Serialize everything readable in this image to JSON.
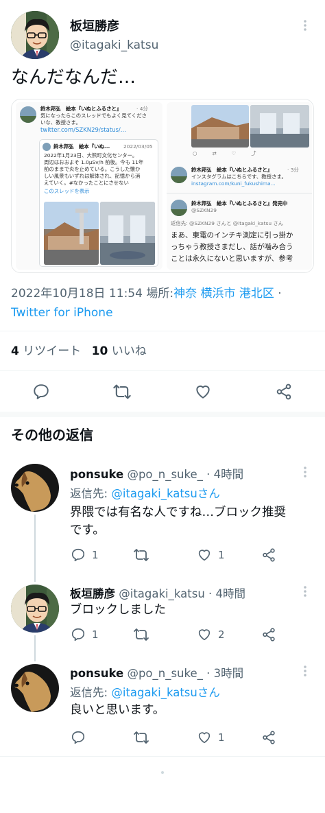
{
  "main_tweet": {
    "author_name": "板垣勝彦",
    "author_handle": "@itagaki_katsu",
    "text": "なんだなんだ…",
    "timestamp": "2022年10月18日 11:54",
    "location_label": "場所:",
    "location": "神奈 横浜市 港北区",
    "location_suffix": "·",
    "client": "Twitter for iPhone",
    "retweets_count": "4",
    "retweets_label": "リツイート",
    "likes_count": "10",
    "likes_label": "いいね"
  },
  "embed": {
    "left": {
      "author": "鈴木邦弘　絵本『いぬとふるさと』",
      "author_time": "· 4分",
      "line1": "気になったらこのスレッドでもよく見てくださ",
      "line2": "いな、教授さま。",
      "link": "twitter.com/SZKN29/status/...",
      "quote_author": "鈴木邦弘　絵本『いぬ...",
      "quote_date": "2022/03/05",
      "quote_lines": [
        "2022年1月23日、大熊町文化センター。",
        "周辺はおおよそ 1.0μSv/h 前後。今も 11年",
        "前のままで炎を止めている。こうした懐か",
        "しい風景もいずれは解体され、記憶から消",
        "えていく。#なかったことにさせない"
      ],
      "thread_link": "このスレッドを表示"
    },
    "right": {
      "author1": "鈴木邦弘　絵本『いぬとふるさと』",
      "author1_time": "· 3分",
      "line1": "インスタグラムはこちらです、教授さま。",
      "link1": "instagram.com/kuni_fukushima...",
      "author2": "鈴木邦弘　絵本『いぬとふるさと』発売中",
      "handle2": "@SZKN29",
      "reply_to": "返信先: @SZKN29 さんと @itagaki_katsu さん",
      "body_lines": [
        "まあ、東電のインチキ測定に引っ掛か",
        "っちゃう教授さまだし、話が噛み合う",
        "ことは永久にないと思いますが、参考"
      ]
    }
  },
  "section_title": "その他の返信",
  "replies": [
    {
      "name": "ponsuke",
      "handle": "@po_n_suke_",
      "time": "· 4時間",
      "reply_prefix": "返信先:",
      "reply_to": "@itagaki_katsuさん",
      "text_lines": [
        "界隈では有名な人ですね…ブロック推奨",
        "です。"
      ],
      "reply_count": "1",
      "retweet_count": "",
      "like_count": "1"
    },
    {
      "name": "板垣勝彦",
      "handle": "@itagaki_katsu",
      "time": "· 4時間",
      "text_lines": [
        "ブロックしました"
      ],
      "reply_count": "1",
      "retweet_count": "",
      "like_count": "2"
    },
    {
      "name": "ponsuke",
      "handle": "@po_n_suke_",
      "time": "· 3時間",
      "reply_prefix": "返信先:",
      "reply_to": "@itagaki_katsuさん",
      "text_lines": [
        "良いと思います。"
      ],
      "reply_count": "",
      "retweet_count": "",
      "like_count": "1"
    }
  ],
  "icons": {
    "reply": "reply-icon",
    "retweet": "retweet-icon",
    "like": "heart-icon",
    "share": "share-icon",
    "more": "more-icon"
  },
  "colors": {
    "link": "#1d9bf0",
    "muted": "#536471",
    "divider": "#eff3f4"
  }
}
